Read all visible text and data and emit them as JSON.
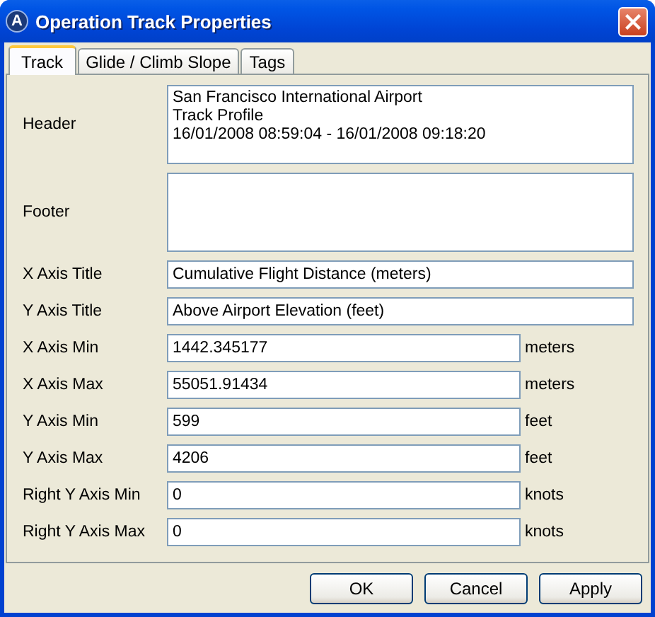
{
  "window": {
    "icon_letter": "A",
    "title": "Operation Track Properties"
  },
  "tabs": [
    {
      "label": "Track",
      "selected": true
    },
    {
      "label": "Glide / Climb Slope",
      "selected": false
    },
    {
      "label": "Tags",
      "selected": false
    }
  ],
  "fields": [
    {
      "kind": "multiline",
      "label": "Header",
      "value": "San Francisco International Airport\nTrack Profile\n16/01/2008 08:59:04 - 16/01/2008 09:18:20"
    },
    {
      "kind": "multiline",
      "label": "Footer"
    },
    {
      "kind": "text",
      "label": "X Axis Title",
      "value": "Cumulative Flight Distance (meters)"
    },
    {
      "kind": "text",
      "label": "Y Axis Title",
      "value": "Above Airport Elevation (feet)"
    },
    {
      "kind": "number",
      "label": "X Axis Min",
      "value": "1442.345177",
      "unit": "meters"
    },
    {
      "kind": "number",
      "label": "X Axis Max",
      "value": "55051.91434",
      "unit": "meters"
    },
    {
      "kind": "number",
      "label": "Y Axis Min",
      "value": "599",
      "unit": "feet"
    },
    {
      "kind": "number",
      "label": "Y Axis Max",
      "value": "4206",
      "unit": "feet"
    },
    {
      "kind": "number",
      "label": "Right Y Axis Min",
      "value": "0",
      "unit": "knots"
    },
    {
      "kind": "number",
      "label": "Right Y Axis Max",
      "value": "0",
      "unit": "knots"
    }
  ],
  "buttons": [
    "OK",
    "Cancel",
    "Apply"
  ]
}
